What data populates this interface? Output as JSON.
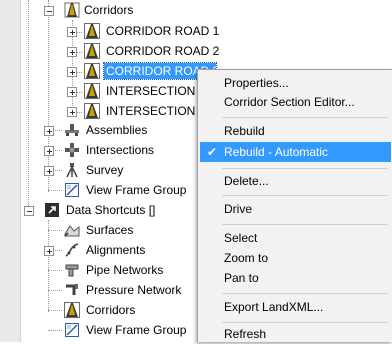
{
  "tree": {
    "corridors_label": "Corridors",
    "corridor_items": [
      "CORRIDOR ROAD 1",
      "CORRIDOR ROAD 2",
      "CORRIDOR ROAD 3",
      "INTERSECTION",
      "INTERSECTION"
    ],
    "assemblies_label": "Assemblies",
    "intersections_label": "Intersections",
    "survey_label": "Survey",
    "view_frame_groups_label": "View Frame Group",
    "data_shortcuts_label": "Data Shortcuts []",
    "ds_surfaces_label": "Surfaces",
    "ds_alignments_label": "Alignments",
    "ds_pipe_networks_label": "Pipe Networks",
    "ds_pressure_networks_label": "Pressure Network",
    "ds_corridors_label": "Corridors",
    "ds_view_frame_groups_label": "View Frame Group"
  },
  "context_menu": {
    "properties": "Properties...",
    "corridor_section_editor": "Corridor Section Editor...",
    "rebuild": "Rebuild",
    "rebuild_automatic": "Rebuild - Automatic",
    "rebuild_automatic_checked": true,
    "delete": "Delete...",
    "drive": "Drive",
    "select": "Select",
    "zoom_to": "Zoom to",
    "pan_to": "Pan to",
    "export_landxml": "Export LandXML...",
    "refresh": "Refresh",
    "check_mark": "✔"
  },
  "colors": {
    "selection": "#3399ff",
    "menu_background": "#f2f2f2",
    "corridor_icon": "#c8a200"
  }
}
